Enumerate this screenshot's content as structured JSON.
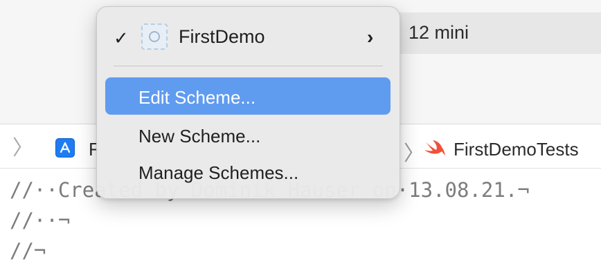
{
  "toolbar": {
    "device_label": "12 mini"
  },
  "jumpbar": {
    "project_label": "F",
    "tests_label": "FirstDemoTests"
  },
  "code_lines": [
    "//··Created by Dominik Hauser on·13.08.21.¬",
    "//··¬",
    "//¬"
  ],
  "menu": {
    "current_scheme": "FirstDemo",
    "items": [
      {
        "label": "Edit Scheme...",
        "highlighted": true
      },
      {
        "label": "New Scheme...",
        "highlighted": false
      },
      {
        "label": "Manage Schemes...",
        "highlighted": false
      }
    ]
  },
  "icons": {
    "check": "checkmark-icon",
    "scheme": "scheme-target-icon",
    "submenu": "chevron-right-icon",
    "app": "app-store-icon",
    "swift": "swift-icon"
  },
  "colors": {
    "highlight": "#5f9cf0",
    "app_icon": "#1e7cf2",
    "swift": "#f05138"
  }
}
